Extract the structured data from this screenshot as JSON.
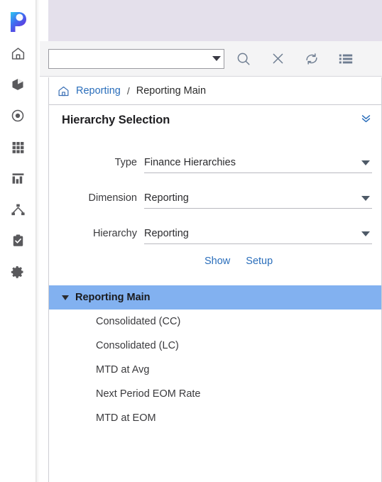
{
  "app": {
    "logo_letter": "P"
  },
  "rail": {
    "items": [
      {
        "icon": "home-icon",
        "name": "home"
      },
      {
        "icon": "cube-icon",
        "name": "models"
      },
      {
        "icon": "target-icon",
        "name": "focus"
      },
      {
        "icon": "grid-icon",
        "name": "grid"
      },
      {
        "icon": "bar-chart-icon",
        "name": "reports"
      },
      {
        "icon": "hierarchy-icon",
        "name": "hierarchy"
      },
      {
        "icon": "clipboard-check-icon",
        "name": "tasks"
      },
      {
        "icon": "gear-icon",
        "name": "settings"
      }
    ]
  },
  "toolbar": {
    "combo_value": "",
    "combo_placeholder": "",
    "buttons": [
      {
        "icon": "search-icon",
        "name": "search"
      },
      {
        "icon": "close-icon",
        "name": "clear"
      },
      {
        "icon": "refresh-icon",
        "name": "refresh"
      },
      {
        "icon": "list-icon",
        "name": "list-view"
      }
    ]
  },
  "breadcrumb": {
    "home_icon": "home-icon",
    "separator": "/",
    "items": [
      {
        "label": "Reporting",
        "link": true
      },
      {
        "label": "Reporting Main",
        "link": false
      }
    ]
  },
  "section": {
    "title": "Hierarchy Selection",
    "collapse_icon": "chevron-double-down-icon"
  },
  "form": {
    "fields": [
      {
        "label": "Type",
        "value": "Finance Hierarchies"
      },
      {
        "label": "Dimension",
        "value": "Reporting"
      },
      {
        "label": "Hierarchy",
        "value": "Reporting"
      }
    ]
  },
  "links": {
    "show": "Show",
    "setup": "Setup"
  },
  "tree": {
    "root": {
      "label": "Reporting Main",
      "expanded": true,
      "selected": true
    },
    "children": [
      {
        "label": "Consolidated (CC)"
      },
      {
        "label": "Consolidated (LC)"
      },
      {
        "label": "MTD at Avg"
      },
      {
        "label": "Next Period EOM Rate"
      },
      {
        "label": "MTD at EOM"
      }
    ]
  },
  "colors": {
    "accent_link": "#2a6ebb",
    "selection": "#82b1f0",
    "topband": "#e4e0eb",
    "toolbar_bg": "#f4f4f5",
    "icon_gray": "#6e7d91"
  }
}
